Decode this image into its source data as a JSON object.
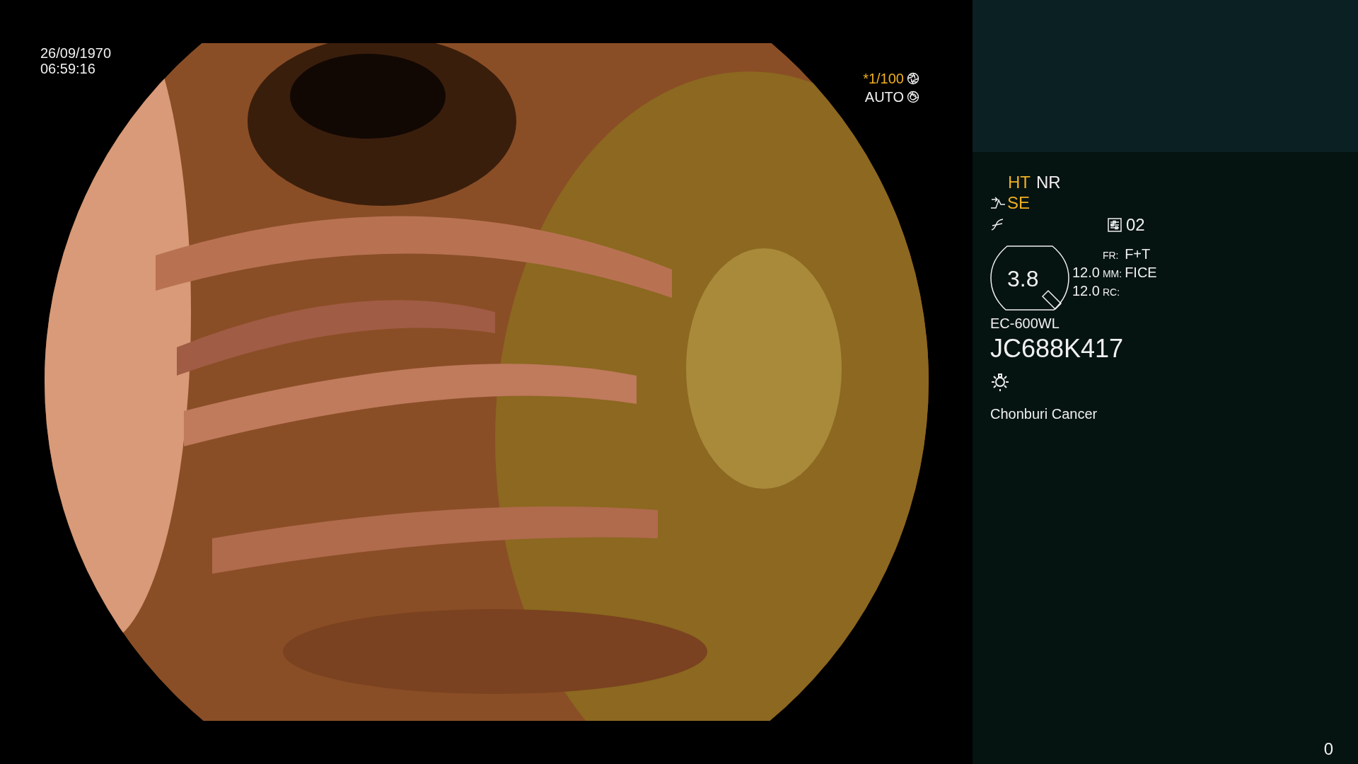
{
  "timestamp": {
    "date": "26/09/1970",
    "time": "06:59:16"
  },
  "exposure": {
    "shutter": "*1/100",
    "iris": "AUTO"
  },
  "flags": [
    {
      "label": "HT",
      "active": true
    },
    {
      "label": "NR",
      "active": false
    }
  ],
  "enhancement": {
    "label": "SE",
    "active": true
  },
  "preset": "02",
  "zoom": "3.8",
  "readings": [
    "12.0",
    "12.0"
  ],
  "modes": [
    {
      "label": "FR:",
      "value": "F+T"
    },
    {
      "label": "MM:",
      "value": "FICE"
    },
    {
      "label": "RC:"
    }
  ],
  "scope": {
    "model": "EC-600WL",
    "serial": "JC688K417"
  },
  "institution": "Chonburi Cancer",
  "counter": "0"
}
